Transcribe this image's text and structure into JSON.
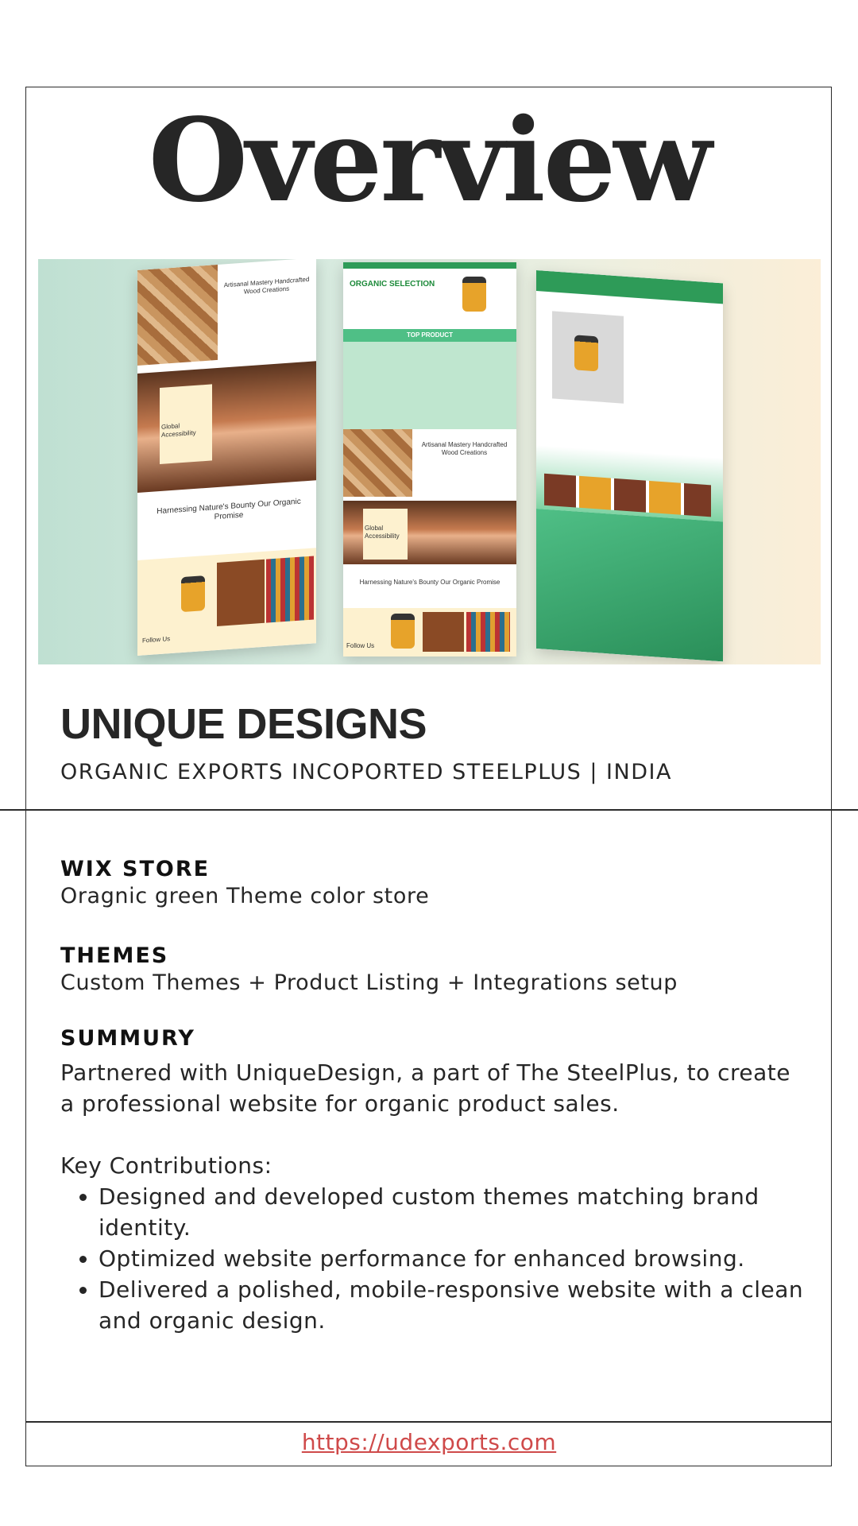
{
  "title": "Overview",
  "hero": {
    "mockup_left": {
      "heading": "Artisanal Mastery Handcrafted Wood Creations",
      "card": "Global Accessibility",
      "banner": "Harnessing Nature's Bounty Our Organic Promise",
      "footer": "Follow Us"
    },
    "mockup_center": {
      "heading": "ORGANIC SELECTION",
      "band": "TOP PRODUCT",
      "heading2": "Artisanal Mastery Handcrafted Wood Creations",
      "card": "Global Accessibility",
      "banner": "Harnessing Nature's Bounty Our Organic Promise",
      "footer": "Follow Us"
    }
  },
  "project": {
    "name": "UNIQUE DESIGNS",
    "subtitle": "ORGANIC EXPORTS INCOPORTED STEELPLUS | INDIA"
  },
  "details": {
    "store_label": "WIX STORE",
    "store_value": "Oragnic green Theme color store",
    "themes_label": "THEMES",
    "themes_value": "Custom Themes + Product Listing + Integrations setup",
    "summary_label": "SUMMURY",
    "summary_text": "Partnered with UniqueDesign, a part of The SteelPlus, to create a professional website for organic product sales.",
    "contributions_label": "Key Contributions:",
    "contributions": [
      "Designed and developed custom themes matching brand identity.",
      "Optimized website performance for enhanced browsing.",
      "Delivered a polished, mobile-responsive website with a clean and organic design."
    ]
  },
  "footer": {
    "link": "https://udexports.com"
  }
}
